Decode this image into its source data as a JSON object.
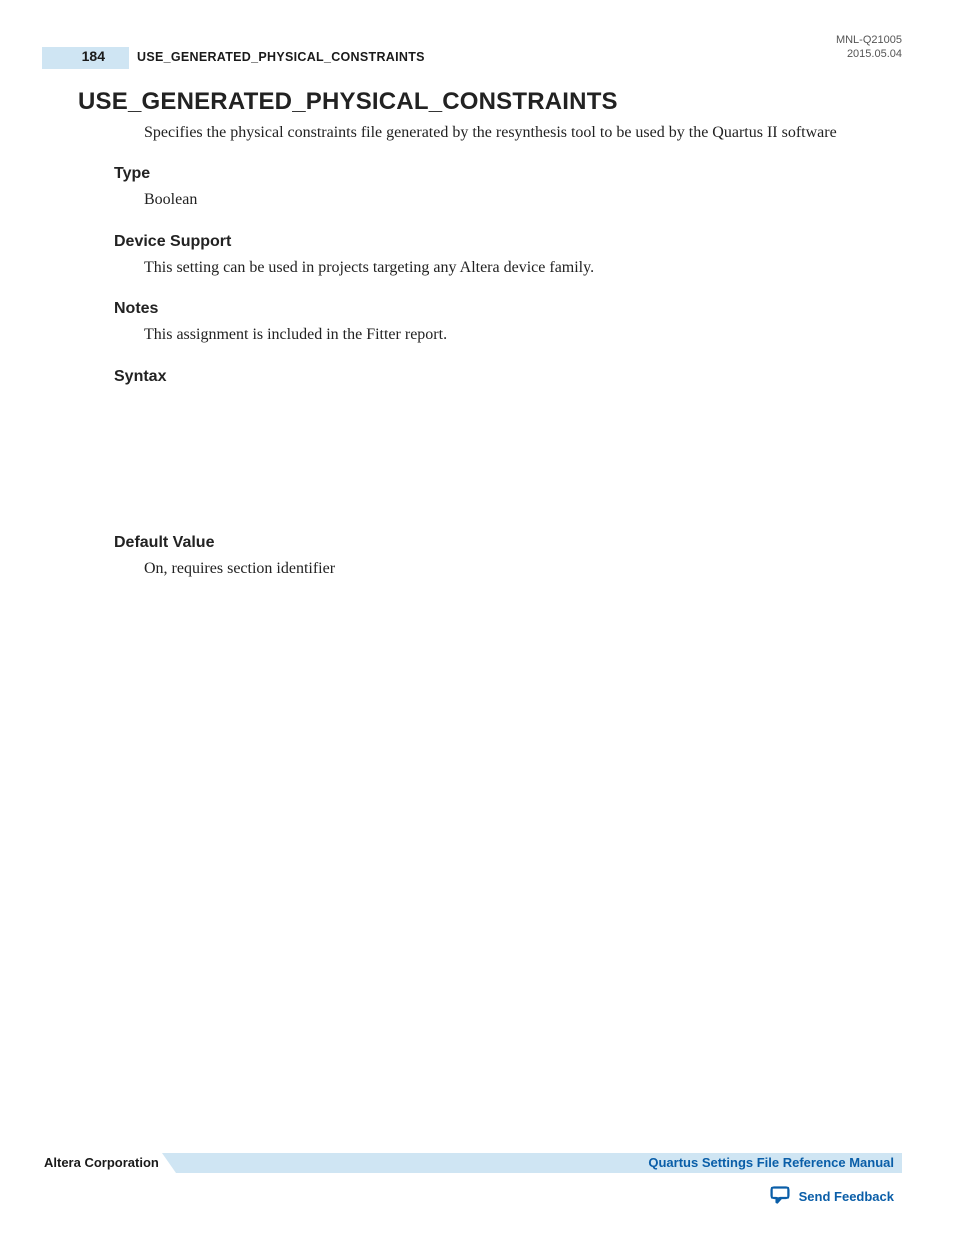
{
  "header": {
    "page_number": "184",
    "running_title": "USE_GENERATED_PHYSICAL_CONSTRAINTS",
    "doc_id": "MNL-Q21005",
    "doc_date": "2015.05.04"
  },
  "body": {
    "title": "USE_GENERATED_PHYSICAL_CONSTRAINTS",
    "description": "Specifies the physical constraints file generated by the resynthesis tool to be used by the Quartus II software",
    "sections": {
      "type": {
        "heading": "Type",
        "text": "Boolean"
      },
      "device_support": {
        "heading": "Device Support",
        "text": "This setting can be used in projects targeting any Altera device family."
      },
      "notes": {
        "heading": "Notes",
        "text": "This assignment is included in the Fitter report."
      },
      "syntax": {
        "heading": "Syntax",
        "text": ""
      },
      "default_value": {
        "heading": "Default Value",
        "text": "On, requires section identifier"
      }
    }
  },
  "footer": {
    "company": "Altera Corporation",
    "manual_title": "Quartus Settings File Reference Manual",
    "feedback_label": "Send Feedback"
  }
}
